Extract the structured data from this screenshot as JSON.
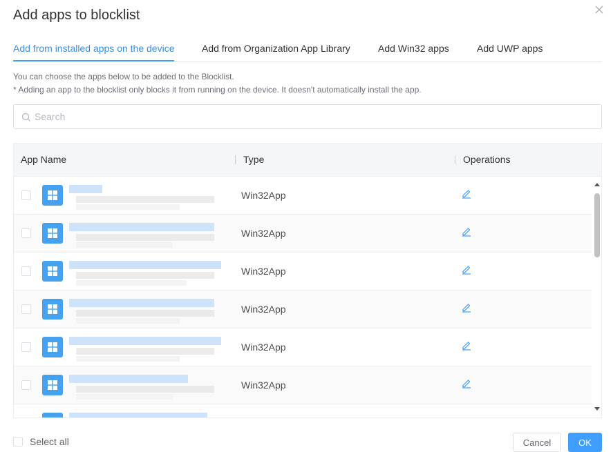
{
  "dialog": {
    "title": "Add apps to blocklist"
  },
  "tabs": [
    {
      "label": "Add from installed apps on the device",
      "active": true
    },
    {
      "label": "Add from Organization App Library",
      "active": false
    },
    {
      "label": "Add Win32 apps",
      "active": false
    },
    {
      "label": "Add UWP apps",
      "active": false
    }
  ],
  "notes": {
    "line1": "You can choose the apps below to be added to the Blocklist.",
    "line2": "* Adding an app to the blocklist only blocks it from running on the device. It doesn't automatically install the app."
  },
  "search": {
    "placeholder": "Search",
    "value": "",
    "icon": "search-icon"
  },
  "table": {
    "columns": {
      "app_name": "App Name",
      "type": "Type",
      "operations": "Operations"
    },
    "rows": [
      {
        "type": "Win32App",
        "icon": "windows-icon",
        "operation_icon": "edit-icon"
      },
      {
        "type": "Win32App",
        "icon": "windows-icon",
        "operation_icon": "edit-icon"
      },
      {
        "type": "Win32App",
        "icon": "windows-icon",
        "operation_icon": "edit-icon"
      },
      {
        "type": "Win32App",
        "icon": "windows-icon",
        "operation_icon": "edit-icon"
      },
      {
        "type": "Win32App",
        "icon": "windows-icon",
        "operation_icon": "edit-icon"
      },
      {
        "type": "Win32App",
        "icon": "windows-icon",
        "operation_icon": "edit-icon"
      },
      {
        "type": "",
        "icon": "windows-icon",
        "operation_icon": "edit-icon"
      }
    ]
  },
  "footer": {
    "select_all_label": "Select all",
    "cancel_label": "Cancel",
    "ok_label": "OK"
  },
  "colors": {
    "accent": "#409eff",
    "active_tab": "#3a8ee6",
    "app_icon_bg": "#46a2ee"
  }
}
